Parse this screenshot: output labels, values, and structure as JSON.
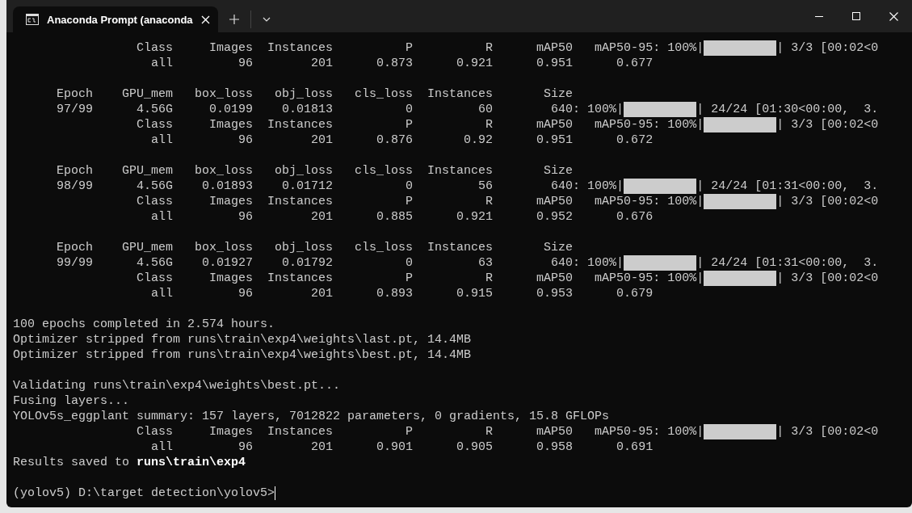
{
  "window": {
    "tab_title": "Anaconda Prompt (anaconda"
  },
  "lines": [
    {
      "kind": "progress",
      "text": "                 Class     Images  Instances          P          R      mAP50   mAP50-95: 100%|",
      "level": 1,
      "after": "| 3/3 [00:02<0"
    },
    {
      "kind": "text",
      "text": "                   all         96        201      0.873      0.921      0.951      0.677"
    },
    {
      "kind": "blank"
    },
    {
      "kind": "text",
      "text": "      Epoch    GPU_mem   box_loss   obj_loss   cls_loss  Instances       Size"
    },
    {
      "kind": "progress",
      "text": "      97/99      4.56G     0.0199    0.01813          0         60        640: 100%|",
      "level": 1,
      "after": "| 24/24 [01:30<00:00,  3."
    },
    {
      "kind": "progress",
      "text": "                 Class     Images  Instances          P          R      mAP50   mAP50-95: 100%|",
      "level": 1,
      "after": "| 3/3 [00:02<0"
    },
    {
      "kind": "text",
      "text": "                   all         96        201      0.876       0.92      0.951      0.672"
    },
    {
      "kind": "blank"
    },
    {
      "kind": "text",
      "text": "      Epoch    GPU_mem   box_loss   obj_loss   cls_loss  Instances       Size"
    },
    {
      "kind": "progress",
      "text": "      98/99      4.56G    0.01893    0.01712          0         56        640: 100%|",
      "level": 1,
      "after": "| 24/24 [01:31<00:00,  3."
    },
    {
      "kind": "progress",
      "text": "                 Class     Images  Instances          P          R      mAP50   mAP50-95: 100%|",
      "level": 1,
      "after": "| 3/3 [00:02<0"
    },
    {
      "kind": "text",
      "text": "                   all         96        201      0.885      0.921      0.952      0.676"
    },
    {
      "kind": "blank"
    },
    {
      "kind": "text",
      "text": "      Epoch    GPU_mem   box_loss   obj_loss   cls_loss  Instances       Size"
    },
    {
      "kind": "progress",
      "text": "      99/99      4.56G    0.01927    0.01792          0         63        640: 100%|",
      "level": 1,
      "after": "| 24/24 [01:31<00:00,  3."
    },
    {
      "kind": "progress",
      "text": "                 Class     Images  Instances          P          R      mAP50   mAP50-95: 100%|",
      "level": 1,
      "after": "| 3/3 [00:02<0"
    },
    {
      "kind": "text",
      "text": "                   all         96        201      0.893      0.915      0.953      0.679"
    },
    {
      "kind": "blank"
    },
    {
      "kind": "text",
      "text": "100 epochs completed in 2.574 hours."
    },
    {
      "kind": "text",
      "text": "Optimizer stripped from runs\\train\\exp4\\weights\\last.pt, 14.4MB"
    },
    {
      "kind": "text",
      "text": "Optimizer stripped from runs\\train\\exp4\\weights\\best.pt, 14.4MB"
    },
    {
      "kind": "blank"
    },
    {
      "kind": "text",
      "text": "Validating runs\\train\\exp4\\weights\\best.pt..."
    },
    {
      "kind": "text",
      "text": "Fusing layers..."
    },
    {
      "kind": "text",
      "text": "YOLOv5s_eggplant summary: 157 layers, 7012822 parameters, 0 gradients, 15.8 GFLOPs"
    },
    {
      "kind": "progress",
      "text": "                 Class     Images  Instances          P          R      mAP50   mAP50-95: 100%|",
      "level": 1,
      "after": "| 3/3 [00:02<0"
    },
    {
      "kind": "text",
      "text": "                   all         96        201      0.901      0.905      0.958      0.691"
    },
    {
      "kind": "text",
      "text": "Results saved to **runs\\train\\exp4**"
    },
    {
      "kind": "blank"
    },
    {
      "kind": "prompt",
      "text": "(yolov5) D:\\target detection\\yolov5>"
    }
  ]
}
